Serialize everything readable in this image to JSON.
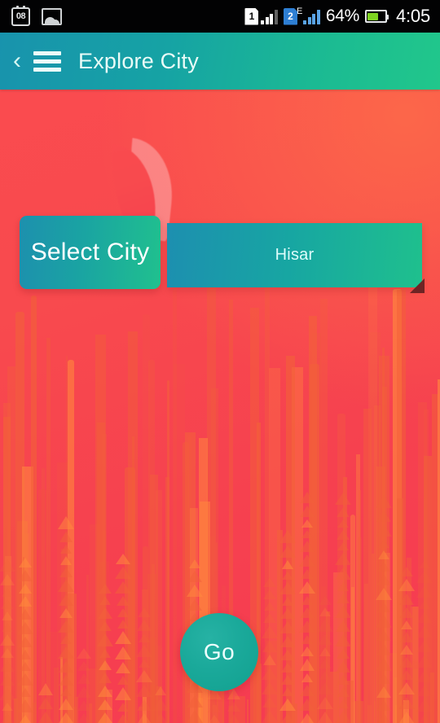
{
  "statusbar": {
    "calendar_day": "08",
    "calendar_icon": "calendar-icon",
    "gallery_icon": "gallery-icon",
    "sim1_label": "1",
    "sim2_label": "2",
    "network_type": "E",
    "battery_percent": "64%",
    "battery_level": 64,
    "time": "4:05"
  },
  "appbar": {
    "back_icon": "‹",
    "menu_icon": "hamburger-menu-icon",
    "title": "Explore City"
  },
  "main": {
    "select_label": "Select City",
    "city_selected": "Hisar",
    "city_options": [
      "Hisar"
    ],
    "go_label": "Go"
  },
  "colors": {
    "appbar_start": "#1893ad",
    "appbar_end": "#21c78b",
    "background_red": "#f84a4e",
    "background_orange": "#ff7e46",
    "button_teal": "#1aa99a",
    "accent_orange": "#ff8a3d",
    "caret_dark": "#6e2424"
  }
}
